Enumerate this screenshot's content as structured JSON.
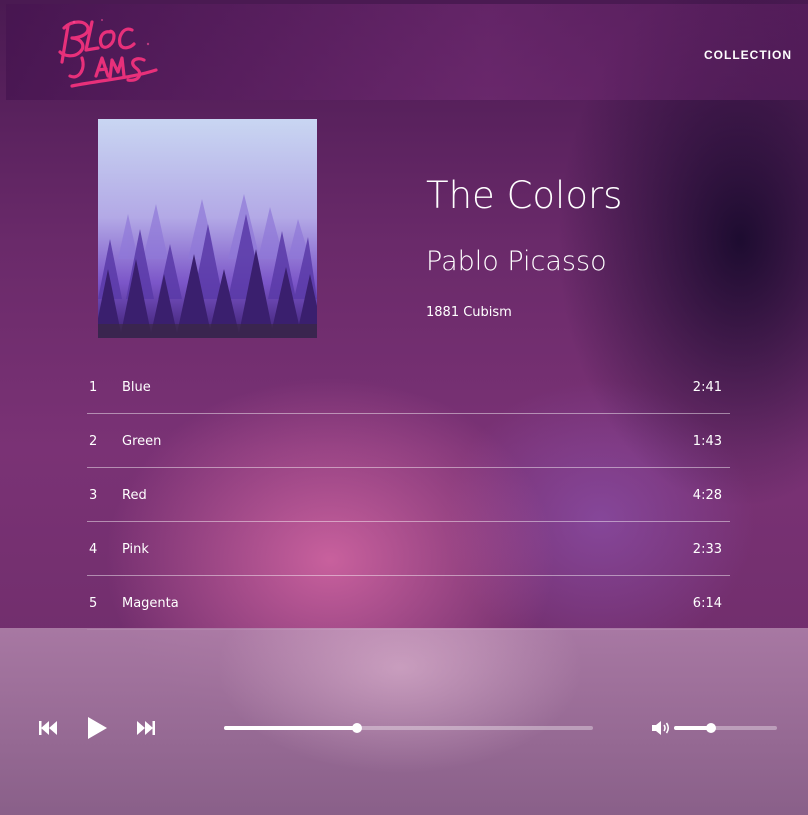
{
  "navbar": {
    "logo_text": "Bloc Jams",
    "collection_link": "COLLECTION"
  },
  "album": {
    "title": "The Colors",
    "artist": "Pablo Picasso",
    "release_info": "1881 Cubism",
    "cover_icon": "misty-forest-cover"
  },
  "songs": [
    {
      "number": "1",
      "title": "Blue",
      "duration": "2:41"
    },
    {
      "number": "2",
      "title": "Green",
      "duration": "1:43"
    },
    {
      "number": "3",
      "title": "Red",
      "duration": "4:28"
    },
    {
      "number": "4",
      "title": "Pink",
      "duration": "2:33"
    },
    {
      "number": "5",
      "title": "Magenta",
      "duration": "6:14"
    }
  ],
  "player": {
    "previous_icon": "skip-previous-icon",
    "play_icon": "play-icon",
    "next_icon": "skip-next-icon",
    "volume_icon": "volume-icon",
    "seek_progress": 0.36,
    "volume_level": 0.36
  },
  "colors": {
    "logo_pink": "#e8307a",
    "divider": "#ffffff"
  }
}
